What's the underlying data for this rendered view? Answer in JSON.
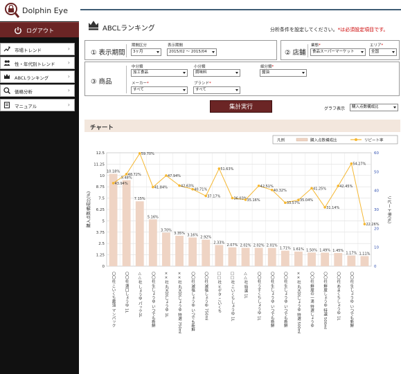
{
  "app": {
    "name": "Dolphin Eye",
    "logout_label": "ログアウト"
  },
  "sidebar": {
    "items": [
      {
        "label": "市場トレンド",
        "icon": "trend-chart-icon"
      },
      {
        "label": "性・年代別トレンド",
        "icon": "people-icon"
      },
      {
        "label": "ABCLランキング",
        "icon": "ranking-icon"
      },
      {
        "label": "価格分析",
        "icon": "yen-search-icon"
      },
      {
        "label": "マニュアル",
        "icon": "manual-icon"
      }
    ]
  },
  "header": {
    "title": "ABCLランキング",
    "notice": "分析条件を設定してください。",
    "notice_req": "*は必須設定項目です。"
  },
  "filters": {
    "period": {
      "section": "① 表示期間",
      "unit_label": "期間区分",
      "unit_value": "3ヶ月",
      "range_label": "表示期間",
      "range_value": "2015/02 ～ 2015/04"
    },
    "store": {
      "section": "② 店舗",
      "type_label": "業態",
      "type_value": "食品スーパーマーケット",
      "area_label": "エリア",
      "area_value": "全国"
    },
    "product": {
      "section": "③ 商品",
      "mid_label": "中分類",
      "mid_value": "加工食品",
      "small_label": "小分類",
      "small_value": "調味料",
      "detail_label": "細分類",
      "detail_value": "醤油",
      "maker_label": "メーカー",
      "maker_value": "すべて",
      "brand_label": "ブランド",
      "brand_value": "すべて"
    },
    "required_mark": "*"
  },
  "actions": {
    "run_label": "集計実行",
    "graph_type_label": "グラフ表示",
    "graph_type_value": "購入点数構成比"
  },
  "chart_section": {
    "title": "チャート"
  },
  "chart_data": {
    "type": "bar",
    "legend_title": "凡例",
    "legend_position": "top-right",
    "grid": true,
    "y_left_label": "購入点数構成比(%)",
    "y_right_label": "リピート率(%)",
    "ylim_left": [
      0,
      12.5
    ],
    "yticks_left": [
      "0",
      "1.25",
      "2.5",
      "3.75",
      "5",
      "6.25",
      "7.5",
      "8.75",
      "10",
      "11.25",
      "12.5"
    ],
    "ylim_right": [
      0,
      60
    ],
    "yticks_right": [
      "0",
      "10",
      "20",
      "30",
      "40",
      "50",
      "60"
    ],
    "categories": [
      "〇〇社 こいくち醤油 マンパック",
      "〇〇社 濃口しょうゆ 1L",
      "△△社 しょうゆ パック1L",
      "〇〇社 生しょうゆ いつでも新鮮",
      "××社 丸大豆しょうゆ 1L",
      "××社 丸大豆しょうゆ 特選 750ml",
      "〇〇社 減塩しょうゆ いつでも新鮮",
      "〇〇社 減塩しょうゆ 750ml",
      "□□社 ヒゲタ こいくち",
      "□□社 こいくちしょうゆ 1L",
      "△△社 特選 1L",
      "〇〇社 うすくちしょうゆ 1L",
      "〇〇社 生しょうゆ いつでも新鮮",
      "〇〇社 生しょうゆ いつでも新鮮",
      "××社 丸大豆しょうゆ 特選 500ml",
      "〇〇社 鮮度の一滴 特選しょうゆ",
      "〇〇社 鮮度しょうゆ 特選 500ml",
      "〇〇社 あまくちしょうゆ 1L",
      "〇〇社 生しょうゆ いつでも新鮮",
      ""
    ],
    "series": [
      {
        "name": "購入点数構成比",
        "axis": "left",
        "type": "bar",
        "color": "#efd4c4",
        "values": [
          10.18,
          9.48,
          7.15,
          5.16,
          3.7,
          3.35,
          3.16,
          2.92,
          2.33,
          2.07,
          2.02,
          2.02,
          2.01,
          1.71,
          1.61,
          1.5,
          1.49,
          1.45,
          1.17,
          1.11
        ],
        "labels": [
          "10.18%",
          "9.48%",
          "7.15%",
          "5.16%",
          "3.70%",
          "3.35%",
          "3.16%",
          "2.92%",
          "2.33%",
          "2.07%",
          "2.02%",
          "2.02%",
          "2.01%",
          "1.71%",
          "1.61%",
          "1.50%",
          "1.49%",
          "1.45%",
          "1.17%",
          "1.11%"
        ]
      },
      {
        "name": "リピート率",
        "axis": "right",
        "type": "line",
        "color": "#f5b731",
        "values": [
          43.94,
          48.72,
          59.7,
          41.84,
          47.94,
          42.63,
          40.71,
          37.17,
          51.63,
          36.03,
          35.16,
          42.51,
          40.32,
          33.57,
          35.04,
          41.25,
          31.14,
          42.45,
          54.27,
          22.26
        ],
        "labels": [
          "43.94%",
          "48.72%",
          "59.70%",
          "41.84%",
          "47.94%",
          "42.63%",
          "40.71%",
          "37.17%",
          "51.63%",
          "36.03%",
          "35.16%",
          "42.51%",
          "40.32%",
          "33.57%",
          "35.04%",
          "41.25%",
          "31.14%",
          "42.45%",
          "54.27%",
          "22.26%"
        ]
      }
    ]
  }
}
